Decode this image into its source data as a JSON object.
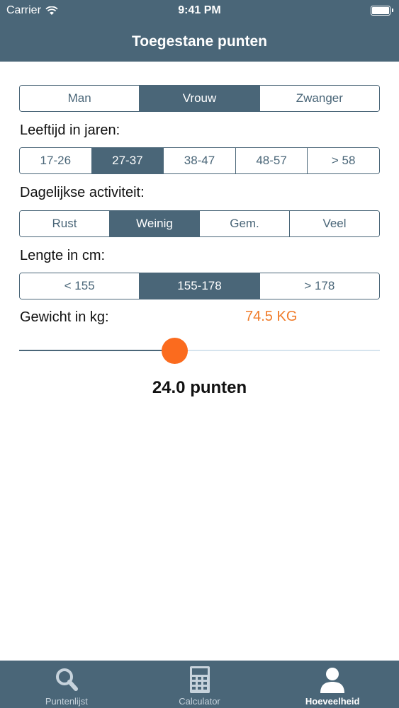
{
  "status": {
    "carrier": "Carrier",
    "time": "9:41 PM"
  },
  "nav": {
    "title": "Toegestane punten"
  },
  "gender": {
    "options": [
      "Man",
      "Vrouw",
      "Zwanger"
    ],
    "selected": 1
  },
  "age": {
    "label": "Leeftijd in jaren:",
    "options": [
      "17-26",
      "27-37",
      "38-47",
      "48-57",
      "> 58"
    ],
    "selected": 1
  },
  "activity": {
    "label": "Dagelijkse activiteit:",
    "options": [
      "Rust",
      "Weinig",
      "Gem.",
      "Veel"
    ],
    "selected": 1
  },
  "height": {
    "label": "Lengte in cm:",
    "options": [
      "< 155",
      "155-178",
      "> 178"
    ],
    "selected": 1
  },
  "weight": {
    "label": "Gewicht in kg:",
    "value": "74.5 KG",
    "slider_fraction": 0.43
  },
  "result": "24.0 punten",
  "tabs": [
    {
      "label": "Puntenlijst",
      "icon": "search-icon"
    },
    {
      "label": "Calculator",
      "icon": "calculator-icon"
    },
    {
      "label": "Hoeveelheid",
      "icon": "person-icon",
      "active": true
    }
  ],
  "colors": {
    "primary": "#4a6678",
    "accent": "#f07c2a",
    "thumb": "#fb6b1e"
  }
}
